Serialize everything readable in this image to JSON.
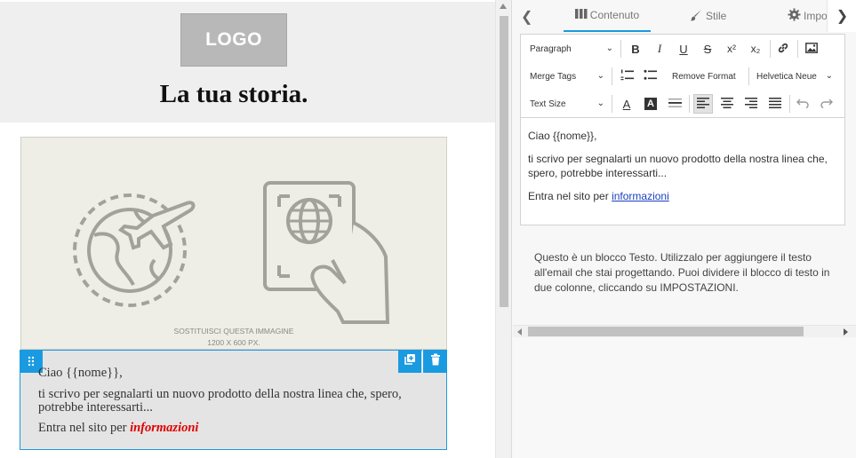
{
  "canvas": {
    "logo_text": "LOGO",
    "title": "La tua storia.",
    "image_caption_line1": "SOSTITUISCI QUESTA IMMAGINE",
    "image_caption_line2": "1200 X 600 PX.",
    "text_block": {
      "greeting": "Ciao {{nome}},",
      "body": "ti scrivo per segnalarti un nuovo prodotto della nostra linea che, spero, potrebbe interessarti...",
      "entra_prefix": "Entra nel sito per ",
      "link_text": "informazioni"
    },
    "icons": [
      "drag-handle-icon",
      "duplicate-icon",
      "trash-icon",
      "globe-plane-icon",
      "passport-hand-icon"
    ]
  },
  "panel": {
    "tabs": [
      {
        "label": "Contenuto",
        "icon": "columns-icon",
        "active": true
      },
      {
        "label": "Stile",
        "icon": "brush-icon",
        "active": false
      },
      {
        "label": "Impo",
        "icon": "gear-icon",
        "active": false
      }
    ],
    "toolbar": {
      "paragraph_select": "Paragraph",
      "merge_tags_select": "Merge Tags",
      "remove_format": "Remove Format",
      "font_select": "Helvetica Neue",
      "text_size_select": "Text Size",
      "bold_glyph": "B",
      "italic_glyph": "I",
      "underline_glyph": "U",
      "strike_glyph": "S",
      "superscript_glyph": "x²",
      "subscript_glyph": "x₂",
      "font_color_glyph": "A",
      "bg_color_glyph": "A"
    },
    "editor_body": {
      "p1": "Ciao {{nome}},",
      "p2": "ti scrivo per segnalarti un nuovo prodotto della nostra linea che, spero, potrebbe interessarti...",
      "p3_prefix": "Entra nel sito per ",
      "p3_link": "informazioni"
    },
    "info_text": "Questo è un blocco Testo. Utilizzalo per aggiungere il testo all'email che stai progettando. Puoi dividere il blocco di testo in due colonne, cliccando su IMPOSTAZIONI."
  },
  "colors": {
    "accent": "#1a9ae0",
    "link_red": "#e00000",
    "editor_link": "#1a3fc0"
  }
}
